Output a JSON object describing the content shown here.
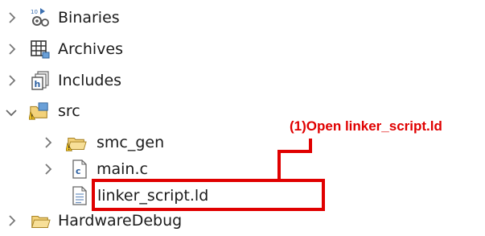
{
  "tree": {
    "items": [
      {
        "label": "Binaries",
        "icon": "binaries-icon",
        "state": "collapsed"
      },
      {
        "label": "Archives",
        "icon": "archives-icon",
        "state": "collapsed"
      },
      {
        "label": "Includes",
        "icon": "includes-icon",
        "state": "collapsed"
      },
      {
        "label": "src",
        "icon": "source-folder-icon",
        "state": "expanded"
      },
      {
        "label": "smc_gen",
        "icon": "folder-warning-icon",
        "state": "collapsed"
      },
      {
        "label": "main.c",
        "icon": "c-file-icon",
        "state": "collapsed"
      },
      {
        "label": "linker_script.ld",
        "icon": "text-file-icon",
        "state": "leaf"
      },
      {
        "label": "HardwareDebug",
        "icon": "folder-icon",
        "state": "collapsed"
      }
    ]
  },
  "annotation": {
    "text": "(1)Open linker_script.ld",
    "color": "#e00000"
  }
}
